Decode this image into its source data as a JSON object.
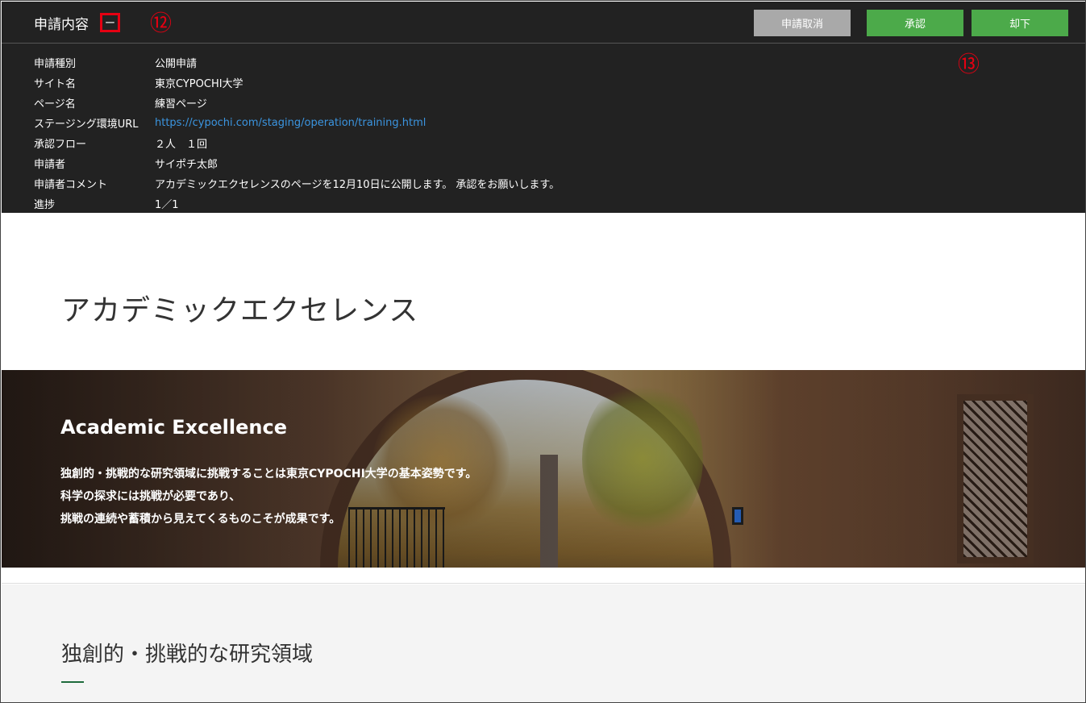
{
  "panel": {
    "title": "申請内容",
    "collapse_label": "ー",
    "marker_collapse": "⑫",
    "marker_actions": "⑬",
    "buttons": {
      "cancel": "申請取消",
      "approve": "承認",
      "reject": "却下"
    },
    "rows": [
      {
        "label": "申請種別",
        "value": "公開申請"
      },
      {
        "label": "サイト名",
        "value": "東京CYPOCHI大学"
      },
      {
        "label": "ページ名",
        "value": "練習ページ"
      },
      {
        "label": "ステージング環境URL",
        "value": "https://cypochi.com/staging/operation/training.html"
      },
      {
        "label": "承認フロー",
        "value": "２人　１回"
      },
      {
        "label": "申請者",
        "value": "サイポチ太郎"
      },
      {
        "label": "申請者コメント",
        "value": "アカデミックエクセレンスのページを12月10日に公開します。 承認をお願いします。"
      },
      {
        "label": "進捗",
        "value": "1／1"
      }
    ]
  },
  "preview": {
    "page_heading": "アカデミックエクセレンス",
    "hero": {
      "title": "Academic Excellence",
      "lines": [
        "独創的・挑戦的な研究領域に挑戦することは東京CYPOCHI大学の基本姿勢です。",
        "科学の探求には挑戦が必要であり、",
        "挑戦の連続や蓄積から見えてくるものこそが成果です。"
      ]
    },
    "section_heading": "独創的・挑戦的な研究領域"
  },
  "colors": {
    "panel_bg": "#222222",
    "approve_green": "#4caa4a",
    "cancel_gray": "#a9a9a9",
    "marker_red": "#e50012",
    "link_blue": "#3b95e0",
    "section_rule_green": "#1e6b3c"
  }
}
